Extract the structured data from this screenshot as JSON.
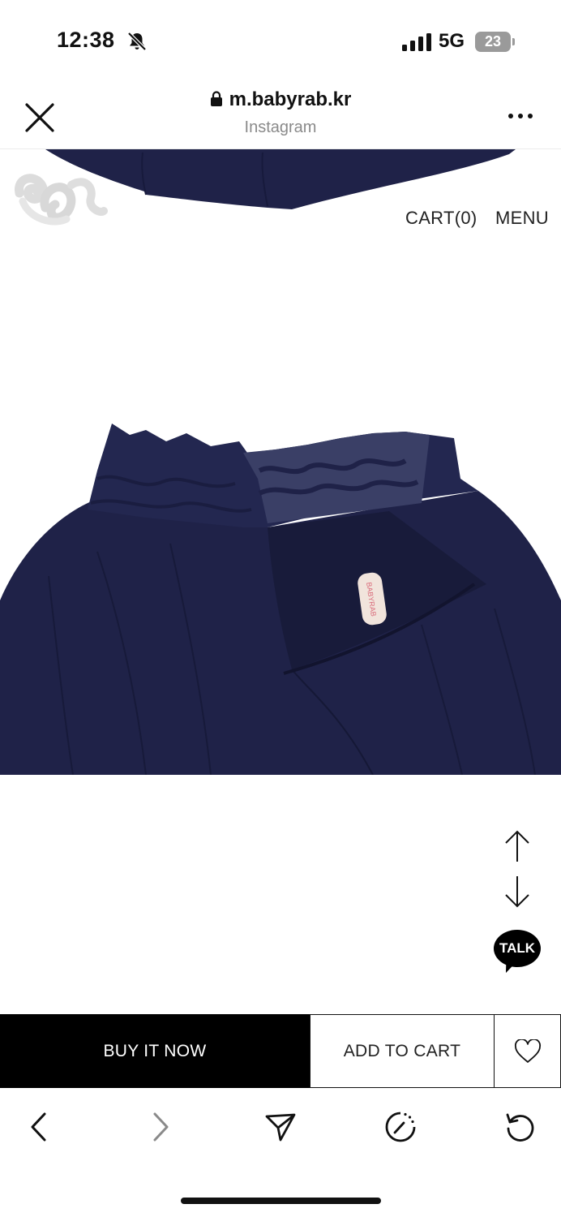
{
  "status_bar": {
    "time": "12:38",
    "network": "5G",
    "battery": "23"
  },
  "browser": {
    "url": "m.babyrab.kr",
    "source": "Instagram"
  },
  "site_nav": {
    "cart_label": "CART(0)",
    "menu_label": "MENU"
  },
  "product": {
    "tag_text": "BABYRAB"
  },
  "floating": {
    "talk_label": "TALK"
  },
  "purchase_bar": {
    "buy_now_label": "BUY IT NOW",
    "add_to_cart_label": "ADD TO CART"
  },
  "icons": {
    "close": "close-icon",
    "lock": "lock-icon",
    "more": "more-icon",
    "scroll_up": "arrow-up-icon",
    "scroll_down": "arrow-down-icon",
    "heart": "heart-icon",
    "back": "chevron-left-icon",
    "forward": "chevron-right-icon",
    "share": "send-icon",
    "history": "clock-icon",
    "reload": "reload-icon"
  },
  "colors": {
    "navy": "#1f2248",
    "buy_now_bg": "#000000",
    "battery": "#9a9a9a"
  }
}
